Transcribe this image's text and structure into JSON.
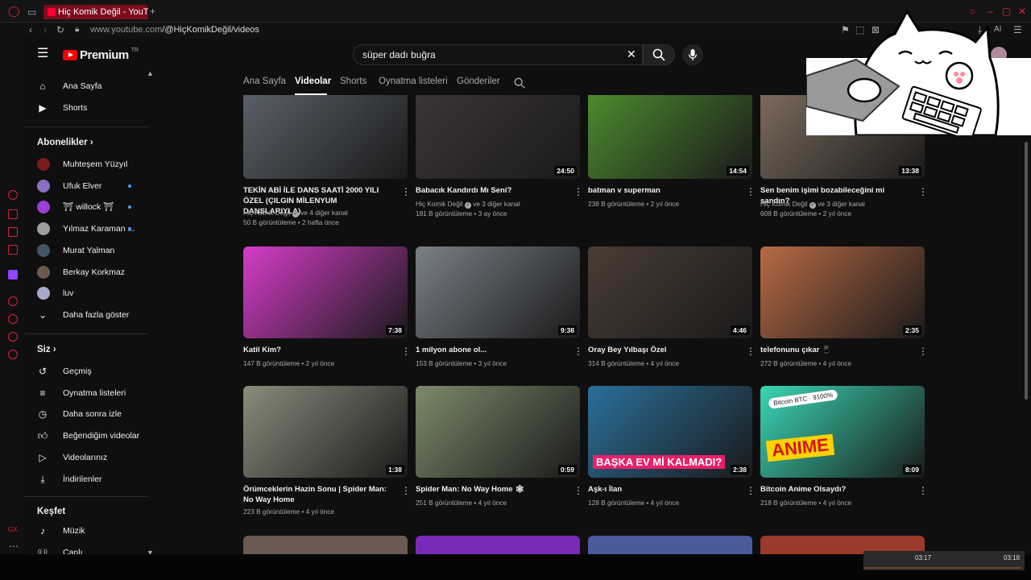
{
  "browser": {
    "tab_title": "Hiç Komik Değil - YouTube",
    "url_host": "www.youtube.com",
    "url_path": "/@HiçKomikDeğil/videos",
    "ai_label": "AI"
  },
  "header": {
    "logo": "Premium",
    "logo_country": "TR",
    "search_value": "süper dadı buğra"
  },
  "sidebar": {
    "main": [
      {
        "label": "Ana Sayfa",
        "icon": "home-icon"
      },
      {
        "label": "Shorts",
        "icon": "shorts-icon"
      }
    ],
    "subscriptions_title": "Abonelikler",
    "subscriptions": [
      {
        "label": "Muhteşem Yüzyıl",
        "color": "#7a1c1c"
      },
      {
        "label": "Ufuk Elver",
        "color": "#8c6fc0",
        "dot": true
      },
      {
        "label": "⛩ willock ⛩",
        "color": "#9a3fd6",
        "dot": true
      },
      {
        "label": "Yılmaz Karaman ...",
        "color": "#9d9d9d",
        "dot": true
      },
      {
        "label": "Murat Yalman",
        "color": "#445566"
      },
      {
        "label": "Berkay Korkmaz",
        "color": "#6b5a4a"
      },
      {
        "label": "luv",
        "color": "#a8a8c8"
      }
    ],
    "show_more": "Daha fazla göster",
    "you_title": "Siz",
    "you": [
      {
        "label": "Geçmiş",
        "icon": "history-icon"
      },
      {
        "label": "Oynatma listeleri",
        "icon": "playlist-icon"
      },
      {
        "label": "Daha sonra izle",
        "icon": "clock-icon"
      },
      {
        "label": "Beğendiğim videolar",
        "icon": "like-icon"
      },
      {
        "label": "Videolarınız",
        "icon": "your-videos-icon"
      },
      {
        "label": "İndirilenler",
        "icon": "download-icon"
      }
    ],
    "explore_title": "Keşfet",
    "explore": [
      {
        "label": "Müzik",
        "icon": "music-icon"
      },
      {
        "label": "Canlı",
        "icon": "live-icon"
      }
    ]
  },
  "channel_tabs": [
    "Ana Sayfa",
    "Videolar",
    "Shorts",
    "Oynatma listeleri",
    "Gönderiler"
  ],
  "active_tab": "Videolar",
  "videos": [
    {
      "title": "TEKİN ABİ İLE DANS SAATİ 2000 YILI ÖZEL (ÇILGIN MİLENYUM DANSLARIYLA)",
      "channel": "Hiç Komik Değil",
      "extra": "ve 4 diğer kanal",
      "meta": "50 B görüntüleme • 2 hafta önce",
      "duration": "",
      "thumb": "#5a6068"
    },
    {
      "title": "Babacık Kandırdı Mı Seni?",
      "channel": "Hiç Komik Değil",
      "extra": "ve 3 diğer kanal",
      "meta": "181 B görüntüleme • 3 ay önce",
      "duration": "24:50",
      "thumb": "#3a3438"
    },
    {
      "title": "batman v superman",
      "channel": "",
      "extra": "",
      "meta": "238 B görüntüleme • 2 yıl önce",
      "duration": "14:54",
      "thumb": "#4c8a2e"
    },
    {
      "title": "Sen benim işimi bozabileceğini mi sandın?",
      "channel": "Hiç Komik Değil",
      "extra": "ve 3 diğer kanal",
      "meta": "608 B görüntüleme • 2 yıl önce",
      "duration": "13:38",
      "thumb": "#7a6a5c"
    },
    {
      "title": "Katil Kim?",
      "channel": "",
      "extra": "",
      "meta": "147 B görüntüleme • 2 yıl önce",
      "duration": "7:38",
      "thumb": "#d43cc8"
    },
    {
      "title": "1 milyon abone ol...",
      "channel": "",
      "extra": "",
      "meta": "153 B görüntüleme • 3 yıl önce",
      "duration": "9:38",
      "thumb": "#7a8088"
    },
    {
      "title": "Oray Bey Yılbaşı Özel",
      "channel": "",
      "extra": "",
      "meta": "314 B görüntüleme • 4 yıl önce",
      "duration": "4:46",
      "thumb": "#4a3c34"
    },
    {
      "title": "telefonunu çıkar 📱",
      "channel": "",
      "extra": "",
      "meta": "272 B görüntüleme • 4 yıl önce",
      "duration": "2:35",
      "thumb": "#b86a44"
    },
    {
      "title": "Örümceklerin Hazin Sonu | Spider Man: No Way Home",
      "channel": "",
      "extra": "",
      "meta": "223 B görüntüleme • 4 yıl önce",
      "duration": "1:38",
      "thumb": "#8a8c7c"
    },
    {
      "title": "Spider Man: No Way Home 🕸",
      "channel": "",
      "extra": "",
      "meta": "251 B görüntüleme • 4 yıl önce",
      "duration": "0:59",
      "thumb": "#7c8a6a"
    },
    {
      "title": "Aşk-ı İlan",
      "channel": "",
      "extra": "",
      "meta": "128 B görüntüleme • 4 yıl önce",
      "duration": "2:38",
      "thumb": "#2a6f9a",
      "overlay": "BAŞKA EV Mİ KALMADI?"
    },
    {
      "title": "Bitcoin Anime Olsaydı?",
      "channel": "",
      "extra": "",
      "meta": "218 B görüntüleme • 4 yıl önce",
      "duration": "8:09",
      "thumb": "#3ad6b4",
      "overlay": "ANIME",
      "badge": "Bitcoin BTC · 9100%"
    }
  ],
  "player": {
    "current": "03:17",
    "total": "03:18"
  },
  "colors": {
    "accent": "#ff0000",
    "opera": "#e0223a",
    "verified": "#aaaaaa"
  }
}
